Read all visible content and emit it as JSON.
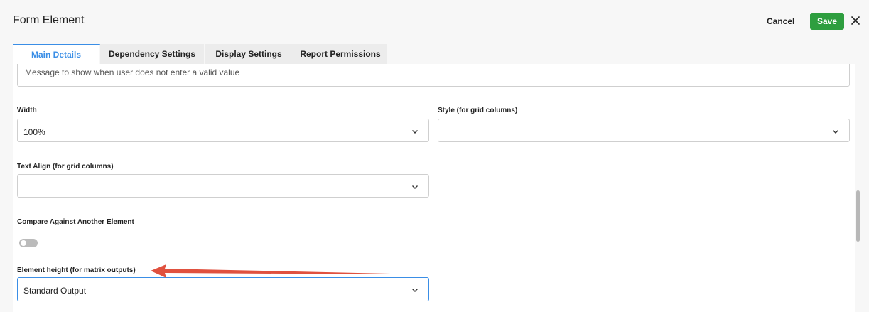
{
  "header": {
    "title": "Form Element",
    "cancel_label": "Cancel",
    "save_label": "Save"
  },
  "tabs": [
    {
      "label": "Main Details",
      "active": true
    },
    {
      "label": "Dependency Settings",
      "active": false
    },
    {
      "label": "Display Settings",
      "active": false
    },
    {
      "label": "Report Permissions",
      "active": false
    }
  ],
  "form": {
    "validation_message": {
      "value": "Message to show when user does not enter a valid value"
    },
    "width": {
      "label": "Width",
      "value": "100%"
    },
    "style": {
      "label": "Style (for grid columns)",
      "value": ""
    },
    "text_align": {
      "label": "Text Align (for grid columns)",
      "value": ""
    },
    "compare": {
      "label": "Compare Against Another Element",
      "enabled": false
    },
    "element_height": {
      "label": "Element height (for matrix outputs)",
      "value": "Standard Output"
    }
  },
  "colors": {
    "accent": "#3a8ee6",
    "save_button": "#2e9e3f",
    "annotation_arrow": "#e0513f"
  },
  "icons": {
    "close": "close-icon",
    "dropdown": "chevron-down-icon"
  }
}
